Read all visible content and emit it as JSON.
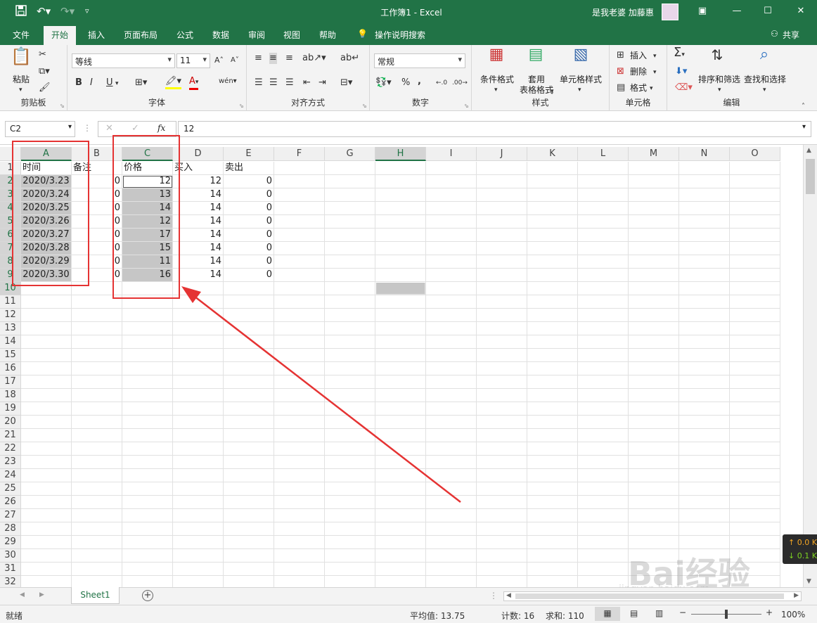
{
  "title_bar": {
    "title": "工作簿1  -  Excel",
    "user": "是我老婆 加藤惠",
    "save_icon": "save-icon",
    "undo_icon": "undo-icon",
    "redo_icon": "redo-icon",
    "customize_icon": "customize-quick-access-icon"
  },
  "tabs": [
    "文件",
    "开始",
    "插入",
    "页面布局",
    "公式",
    "数据",
    "审阅",
    "视图",
    "帮助"
  ],
  "active_tab": "开始",
  "tell_me": "操作说明搜索",
  "share": "共享",
  "ribbon": {
    "clipboard": {
      "label": "剪贴板",
      "paste": "粘贴"
    },
    "font": {
      "label": "字体",
      "name": "等线",
      "size": "11",
      "bold": "B",
      "italic": "I",
      "underline": "U"
    },
    "alignment": {
      "label": "对齐方式"
    },
    "number": {
      "label": "数字",
      "format": "常规",
      "percent": "%",
      "comma": ","
    },
    "styles": {
      "label": "样式",
      "conditional": "条件格式",
      "table_format_1": "套用",
      "table_format_2": "表格格式",
      "cell_styles": "单元格样式"
    },
    "cells": {
      "label": "单元格",
      "insert": "插入",
      "delete": "删除",
      "format": "格式"
    },
    "editing": {
      "label": "编辑",
      "sort_filter": "排序和筛选",
      "find_select": "查找和选择"
    }
  },
  "formula_bar": {
    "name_box": "C2",
    "fx": "fx",
    "value": "12"
  },
  "columns": [
    "A",
    "B",
    "C",
    "D",
    "E",
    "F",
    "G",
    "H",
    "I",
    "J",
    "K",
    "L",
    "M",
    "N",
    "O"
  ],
  "rows": [
    "1",
    "2",
    "3",
    "4",
    "5",
    "6",
    "7",
    "8",
    "9",
    "10",
    "11",
    "12",
    "13",
    "14",
    "15",
    "16",
    "17",
    "18",
    "19",
    "20",
    "21",
    "22",
    "23",
    "24",
    "25",
    "26",
    "27",
    "28",
    "29",
    "30",
    "31",
    "32"
  ],
  "cells": {
    "header": [
      "时间",
      "备注",
      "价格",
      "买入",
      "卖出"
    ],
    "data": [
      [
        "2020/3.23",
        "0",
        "12",
        "12",
        "0"
      ],
      [
        "2020/3.24",
        "0",
        "13",
        "14",
        "0"
      ],
      [
        "2020/3.25",
        "0",
        "14",
        "14",
        "0"
      ],
      [
        "2020/3.26",
        "0",
        "12",
        "14",
        "0"
      ],
      [
        "2020/3.27",
        "0",
        "17",
        "14",
        "0"
      ],
      [
        "2020/3.28",
        "0",
        "15",
        "14",
        "0"
      ],
      [
        "2020/3.29",
        "0",
        "11",
        "14",
        "0"
      ],
      [
        "2020/3.30",
        "0",
        "16",
        "14",
        "0"
      ]
    ]
  },
  "sheet_tab": "Sheet1",
  "status": {
    "ready": "就绪",
    "average": "平均值: 13.75",
    "count": "计数: 16",
    "sum": "求和: 110",
    "zoom": "100%"
  },
  "net_badge": {
    "up": "↑ 0.0 K",
    "down": "↓ 0.1 K"
  },
  "watermark": {
    "main": "Bai经验",
    "url": "jingyan.baidu.com"
  },
  "colors": {
    "excel_green": "#217346",
    "selection_gray": "#c6c6c6",
    "annotation_red": "#e53333"
  }
}
